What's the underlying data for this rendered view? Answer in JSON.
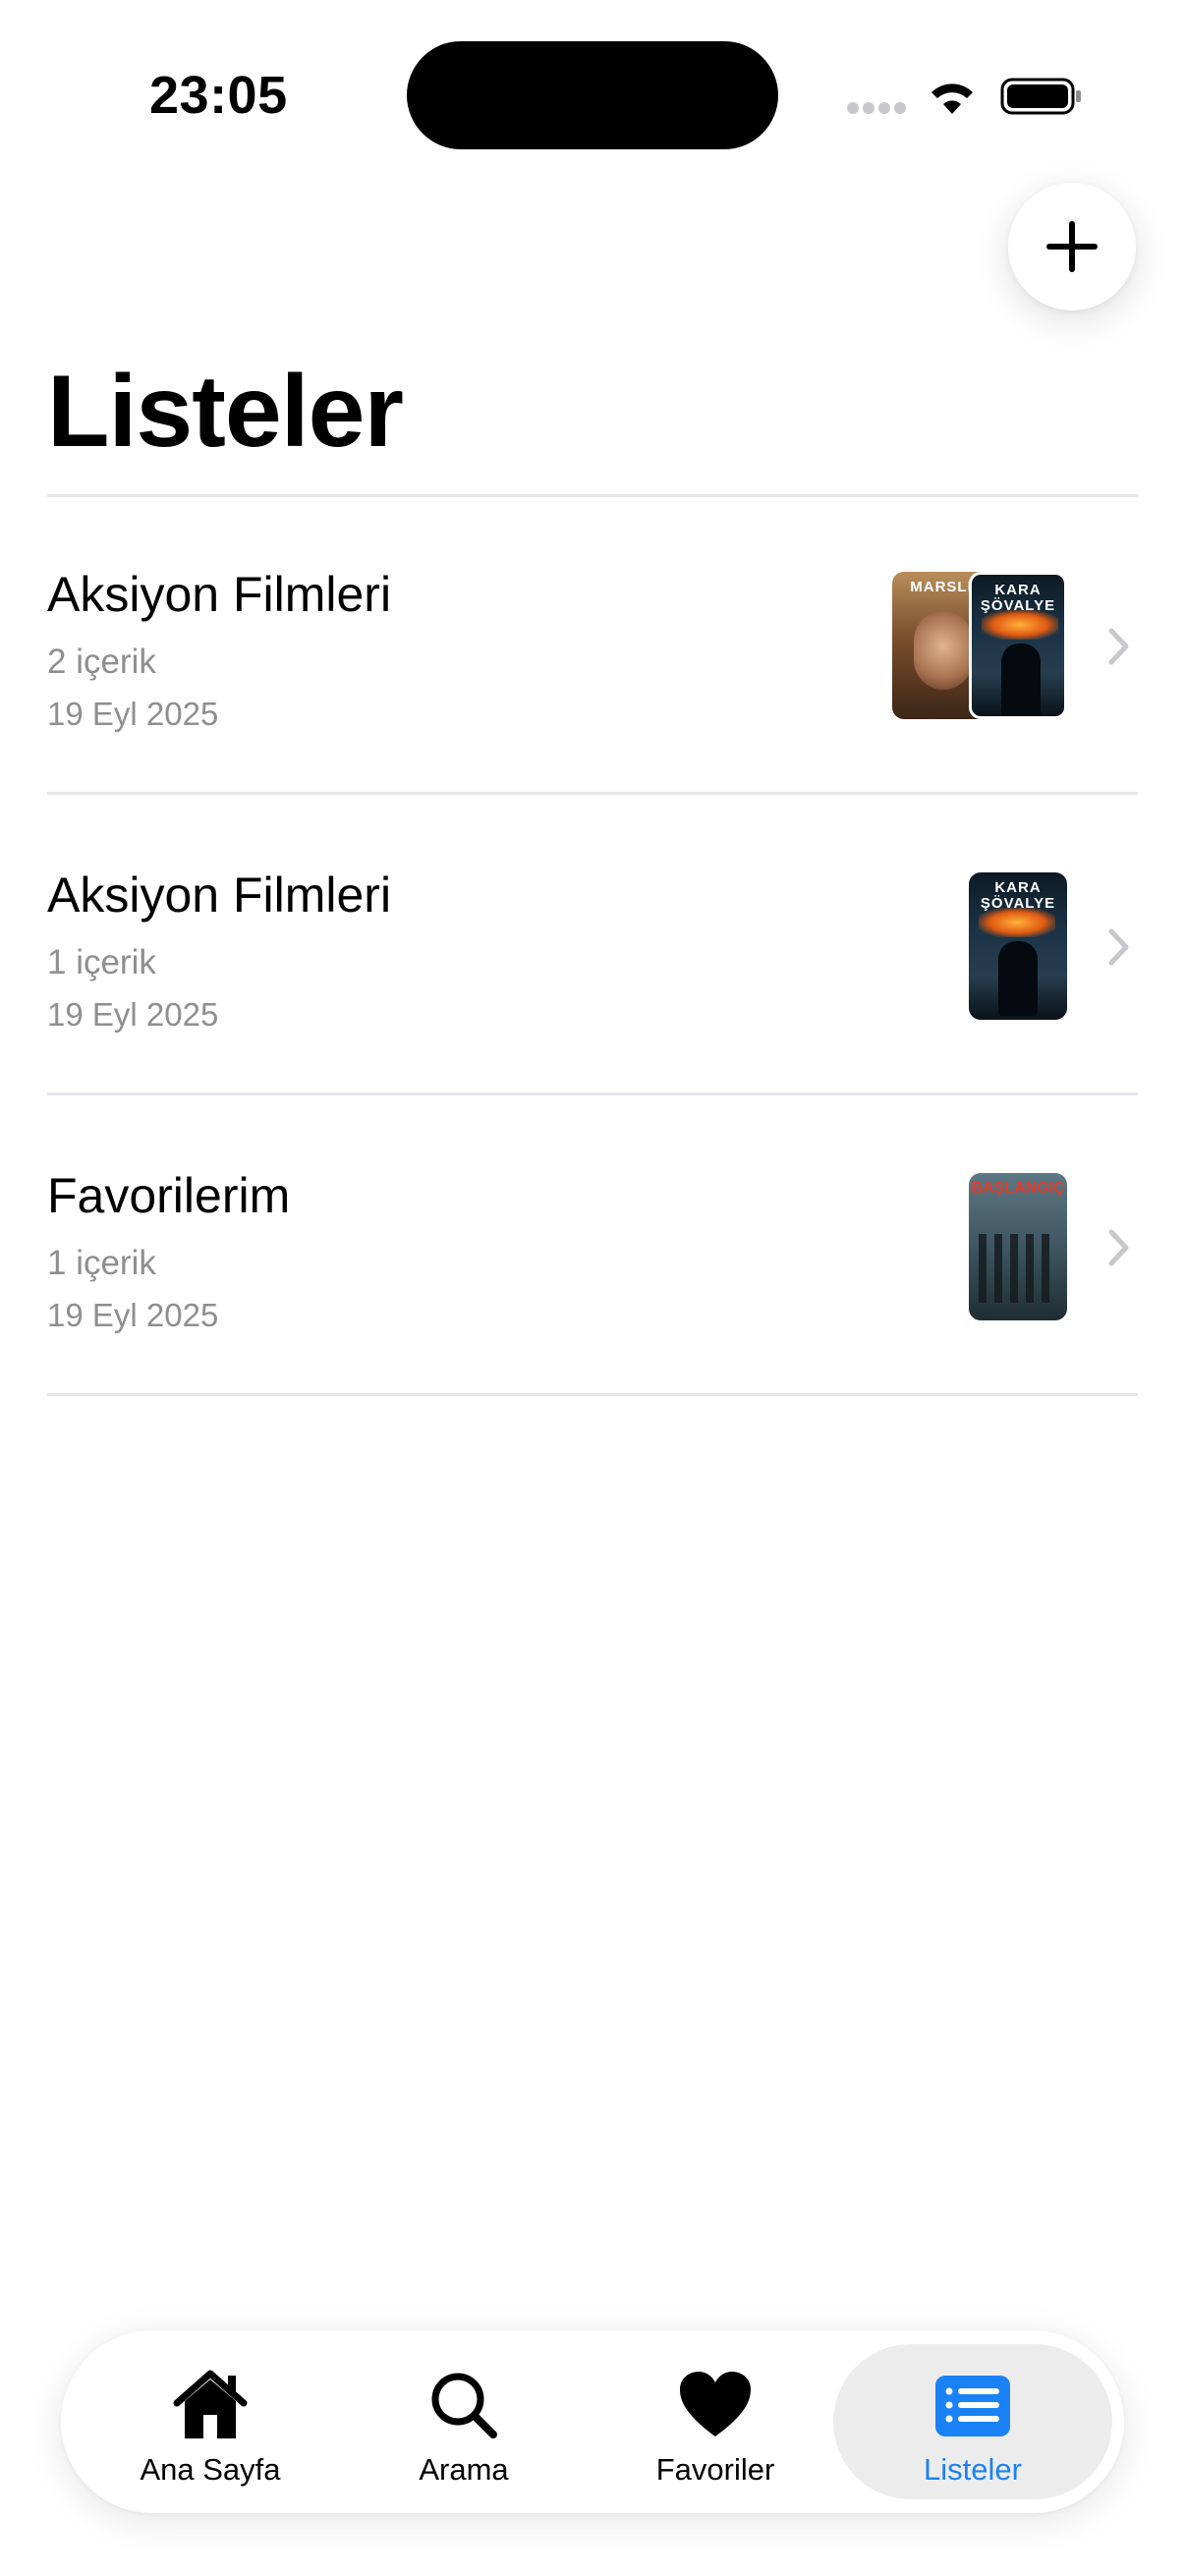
{
  "status_bar": {
    "time": "23:05"
  },
  "header": {
    "title": "Listeler",
    "add_button_icon": "plus-icon"
  },
  "lists": [
    {
      "name": "Aksiyon Filmleri",
      "count": "2 içerik",
      "date": "19 Eyl 2025",
      "posters": [
        {
          "title_text": "MARSLI"
        },
        {
          "title_text": "KARA ŞÖVALYE"
        }
      ]
    },
    {
      "name": "Aksiyon Filmleri",
      "count": "1 içerik",
      "date": "19 Eyl 2025",
      "posters": [
        {
          "title_text": "KARA ŞÖVALYE"
        }
      ]
    },
    {
      "name": "Favorilerim",
      "count": "1 içerik",
      "date": "19 Eyl 2025",
      "posters": [
        {
          "title_text": "BAŞLANGIÇ"
        }
      ]
    }
  ],
  "tab_bar": {
    "items": [
      {
        "label": "Ana Sayfa",
        "icon": "house-icon"
      },
      {
        "label": "Arama",
        "icon": "magnifier-icon"
      },
      {
        "label": "Favoriler",
        "icon": "heart-icon"
      },
      {
        "label": "Listeler",
        "icon": "list-icon"
      }
    ],
    "active_index": 3,
    "active_color": "#1a82f5"
  }
}
